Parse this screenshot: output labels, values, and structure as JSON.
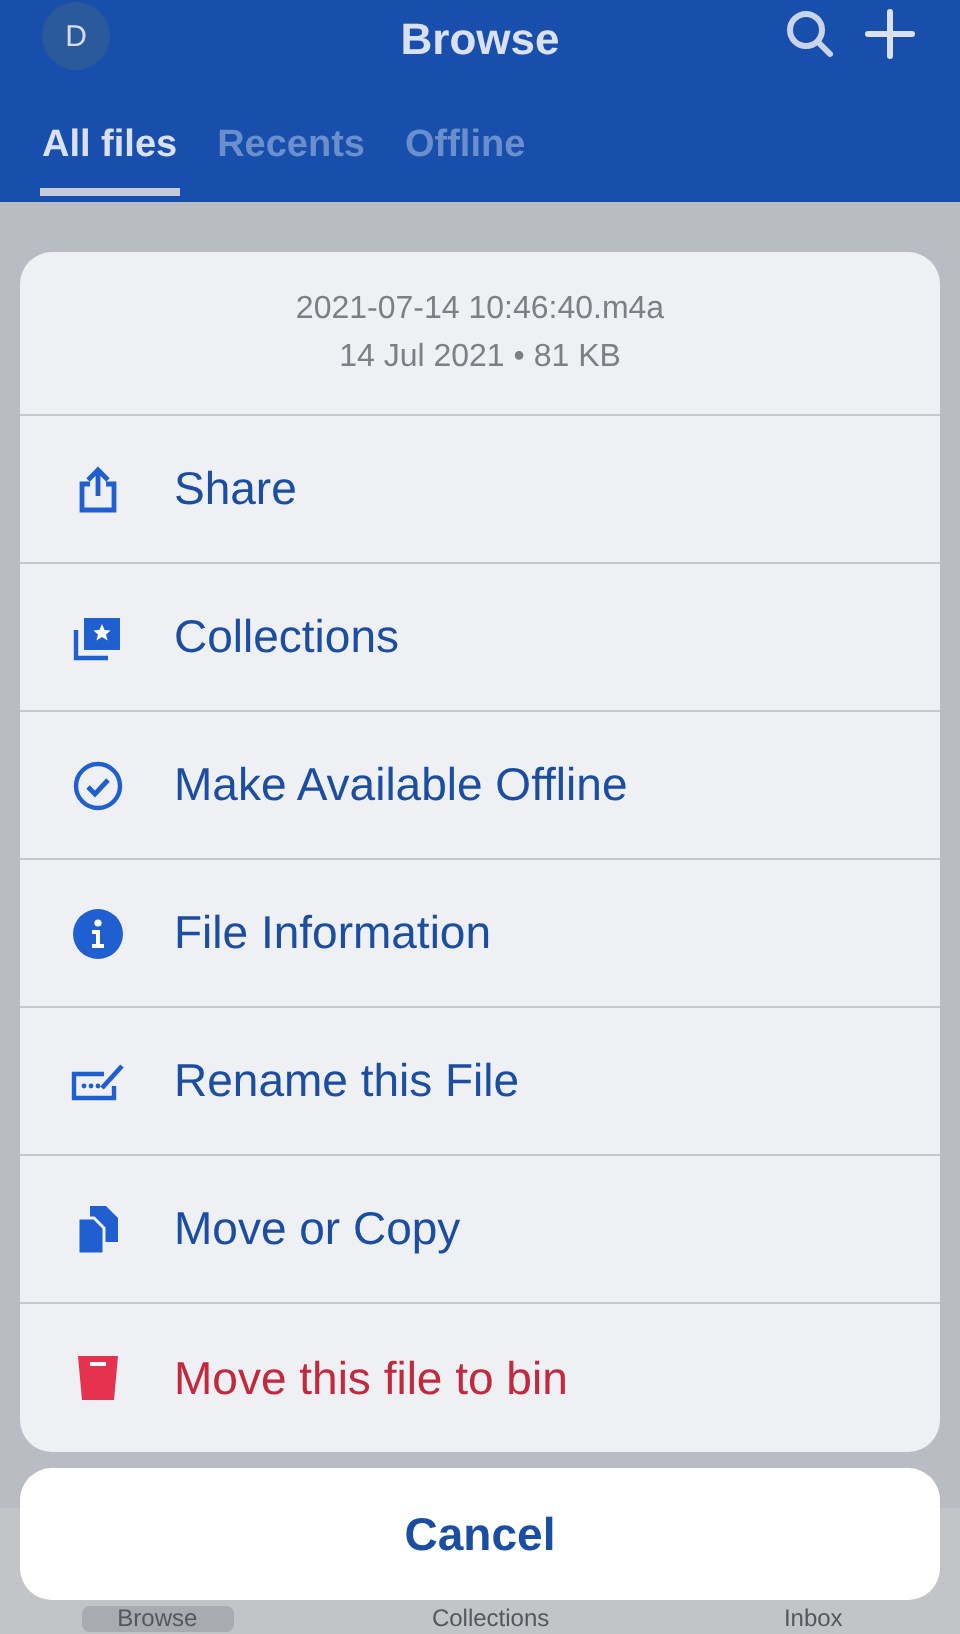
{
  "header": {
    "avatar": "D",
    "title": "Browse"
  },
  "tabs": [
    {
      "label": "All files",
      "selected": true
    },
    {
      "label": "Recents",
      "selected": false
    },
    {
      "label": "Offline",
      "selected": false
    }
  ],
  "bottom_tabs": [
    {
      "label": "Browse",
      "selected": true
    },
    {
      "label": "Collections",
      "selected": false
    },
    {
      "label": "Inbox",
      "selected": false
    }
  ],
  "sheet": {
    "file_name": "2021-07-14 10:46:40.m4a",
    "file_meta": "14 Jul 2021 • 81 KB",
    "actions": [
      {
        "label": "Share",
        "kind": "action"
      },
      {
        "label": "Collections",
        "kind": "action"
      },
      {
        "label": "Make Available Offline",
        "kind": "action"
      },
      {
        "label": "File Information",
        "kind": "action"
      },
      {
        "label": "Rename this File",
        "kind": "action"
      },
      {
        "label": "Move or Copy",
        "kind": "action"
      },
      {
        "label": "Move this file to bin",
        "kind": "destructive"
      }
    ],
    "cancel": "Cancel"
  }
}
